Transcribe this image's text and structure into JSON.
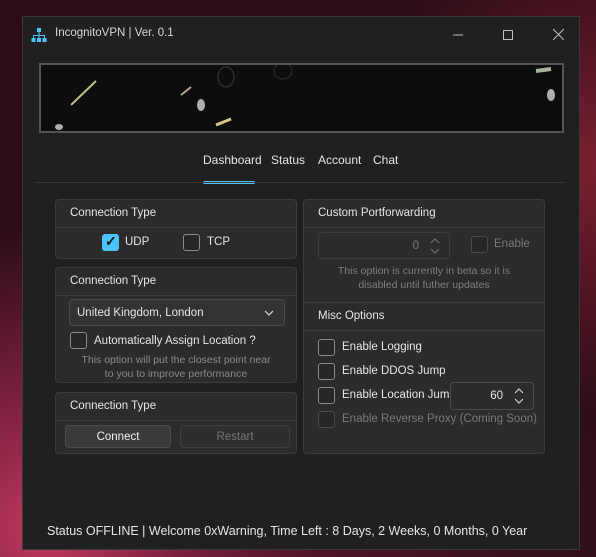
{
  "window": {
    "title": "IncognitoVPN | Ver. 0.1"
  },
  "tabs": [
    "Dashboard",
    "Status",
    "Account",
    "Chat"
  ],
  "connection_protocol": {
    "title": "Connection Type",
    "udp_label": "UDP",
    "udp_checked": true,
    "tcp_label": "TCP",
    "tcp_checked": false
  },
  "location": {
    "title": "Connection Type",
    "selected": "United Kingdom, London",
    "auto_label": "Automatically Assign Location ?",
    "auto_note": "This option will put the closest point near to you to improve performance"
  },
  "connect": {
    "title": "Connection Type",
    "connect_label": "Connect",
    "restart_label": "Restart"
  },
  "portforwarding": {
    "title": "Custom Portforwarding",
    "port_value": "0",
    "enable_label": "Enable",
    "note": "This option is currently in beta so it is disabled until futher updates"
  },
  "misc": {
    "title": "Misc Options",
    "logging_label": "Enable Logging",
    "ddos_label": "Enable DDOS Jump",
    "location_jump_label": "Enable Location Jump",
    "location_jump_value": "60",
    "proxy_label": "Enable Reverse Proxy (Coming Soon)"
  },
  "status": {
    "text": "Status OFFLINE | Welcome  0xWarning, Time Left : 8 Days, 2 Weeks, 0 Months, 0 Year"
  },
  "colors": {
    "accent": "#4cc2ff",
    "window_bg": "#202020",
    "panel_bg": "#2b2b2b"
  }
}
